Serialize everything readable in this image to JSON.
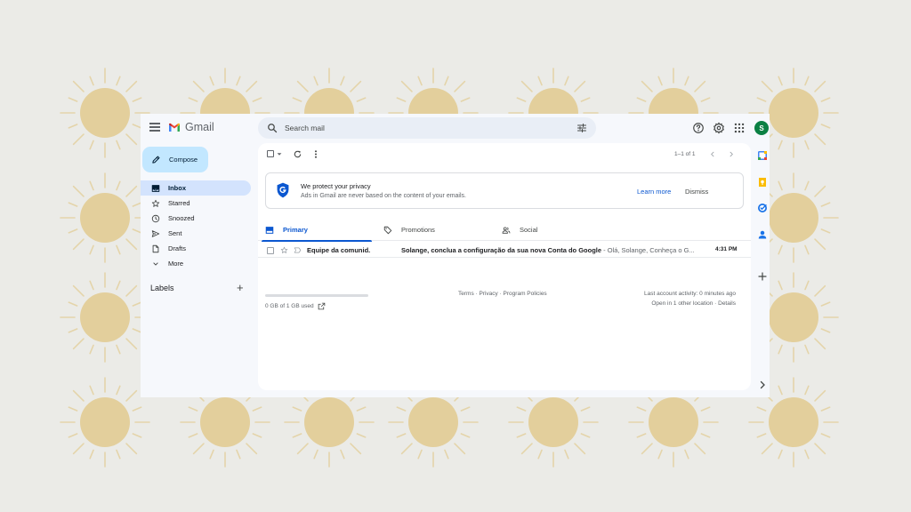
{
  "app": {
    "name": "Gmail"
  },
  "search": {
    "placeholder": "Search mail",
    "value": ""
  },
  "header": {
    "avatar_initial": "S",
    "icons": [
      "help-icon",
      "settings-icon",
      "apps-grid-icon"
    ]
  },
  "compose": {
    "label": "Compose"
  },
  "sidebar": {
    "items": [
      {
        "label": "Inbox",
        "icon": "inbox-icon",
        "active": true
      },
      {
        "label": "Starred",
        "icon": "star-icon"
      },
      {
        "label": "Snoozed",
        "icon": "clock-icon"
      },
      {
        "label": "Sent",
        "icon": "send-icon"
      },
      {
        "label": "Drafts",
        "icon": "draft-icon"
      },
      {
        "label": "More",
        "icon": "chevron-down-icon"
      }
    ],
    "labels_heading": "Labels"
  },
  "toolbar": {
    "pagination": "1–1 of 1"
  },
  "banner": {
    "title": "We protect your privacy",
    "text": "Ads in Gmail are never based on the content of your emails.",
    "learn_more": "Learn more",
    "dismiss": "Dismiss"
  },
  "tabs": [
    {
      "label": "Primary",
      "icon": "inbox-icon",
      "active": true
    },
    {
      "label": "Promotions",
      "icon": "tag-icon"
    },
    {
      "label": "Social",
      "icon": "people-icon"
    }
  ],
  "emails": [
    {
      "sender": "Equipe da comunid.",
      "subject": "Solange, conclua a configuração da sua nova Conta do Google",
      "preview": " - Olá, Solange, Conheça o G...",
      "time": "4:31 PM",
      "unread": true
    }
  ],
  "footer": {
    "storage": "0 GB of 1 GB used",
    "storage_fraction": 0,
    "links": "Terms · Privacy · Program Policies",
    "last_activity": "Last account activity: 0 minutes ago",
    "other_location_prefix": "Open in 1 other location · ",
    "details": "Details"
  },
  "side_panel": {
    "icons": [
      "calendar-icon",
      "keep-icon",
      "tasks-icon",
      "contacts-icon",
      "add-icon",
      "chevron-right-icon"
    ]
  },
  "colors": {
    "accent": "#0b57d0",
    "compose_bg": "#c2e7ff",
    "active_nav": "#d3e3fd",
    "avatar": "#0b8043",
    "sun": "#e3cf9c",
    "backdrop": "#ebebe7"
  }
}
